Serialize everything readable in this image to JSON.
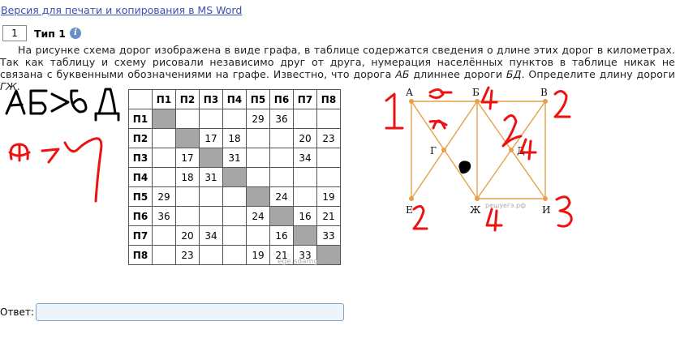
{
  "header": {
    "print_link": "Версия для печати и копирования в MS Word"
  },
  "task": {
    "number": "1",
    "type_label": "Тип 1",
    "info_icon": "info-icon",
    "statement_parts": [
      "На рисунке схема дорог изображена в виде графа, в таблице содержатся сведения о длине этих дорог в километрах. Так как таблицу и схему рисовали независимо друг от друга, нумерация населённых пунктов в таблице никак не связана с буквенными обозначениями на графе. Известно, что дорога ",
      "АБ",
      " длиннее дороги ",
      "БД",
      ". Определите длину дороги ",
      "ГЖ",
      "."
    ]
  },
  "table": {
    "headers": [
      "П1",
      "П2",
      "П3",
      "П4",
      "П5",
      "П6",
      "П7",
      "П8"
    ],
    "rows": [
      {
        "label": "П1",
        "cells": [
          "",
          "",
          "",
          "",
          "29",
          "36",
          "",
          ""
        ]
      },
      {
        "label": "П2",
        "cells": [
          "",
          "",
          "17",
          "18",
          "",
          "",
          "20",
          "23"
        ]
      },
      {
        "label": "П3",
        "cells": [
          "",
          "17",
          "",
          "31",
          "",
          "",
          "34",
          ""
        ]
      },
      {
        "label": "П4",
        "cells": [
          "",
          "18",
          "31",
          "",
          "",
          "",
          "",
          ""
        ]
      },
      {
        "label": "П5",
        "cells": [
          "29",
          "",
          "",
          "",
          "",
          "24",
          "",
          "19"
        ]
      },
      {
        "label": "П6",
        "cells": [
          "36",
          "",
          "",
          "",
          "24",
          "",
          "16",
          "21"
        ]
      },
      {
        "label": "П7",
        "cells": [
          "",
          "20",
          "34",
          "",
          "",
          "16",
          "",
          "33"
        ]
      },
      {
        "label": "П8",
        "cells": [
          "",
          "23",
          "",
          "",
          "19",
          "21",
          "33",
          ""
        ]
      }
    ],
    "watermark": "ege.sdamgia.ru"
  },
  "graph": {
    "vertices": [
      "А",
      "Б",
      "В",
      "Г",
      "Д",
      "Е",
      "Ж",
      "И"
    ],
    "watermark": "решуегэ.рф",
    "edge_color": "#e6a04a"
  },
  "answer": {
    "label": "Ответ:",
    "value": ""
  },
  "annotations": {
    "color": "#ee1111",
    "inequality": "АБ>БД",
    "marks": [
      "1",
      "2",
      "4",
      "2",
      "4",
      "3",
      "4",
      "2"
    ]
  }
}
